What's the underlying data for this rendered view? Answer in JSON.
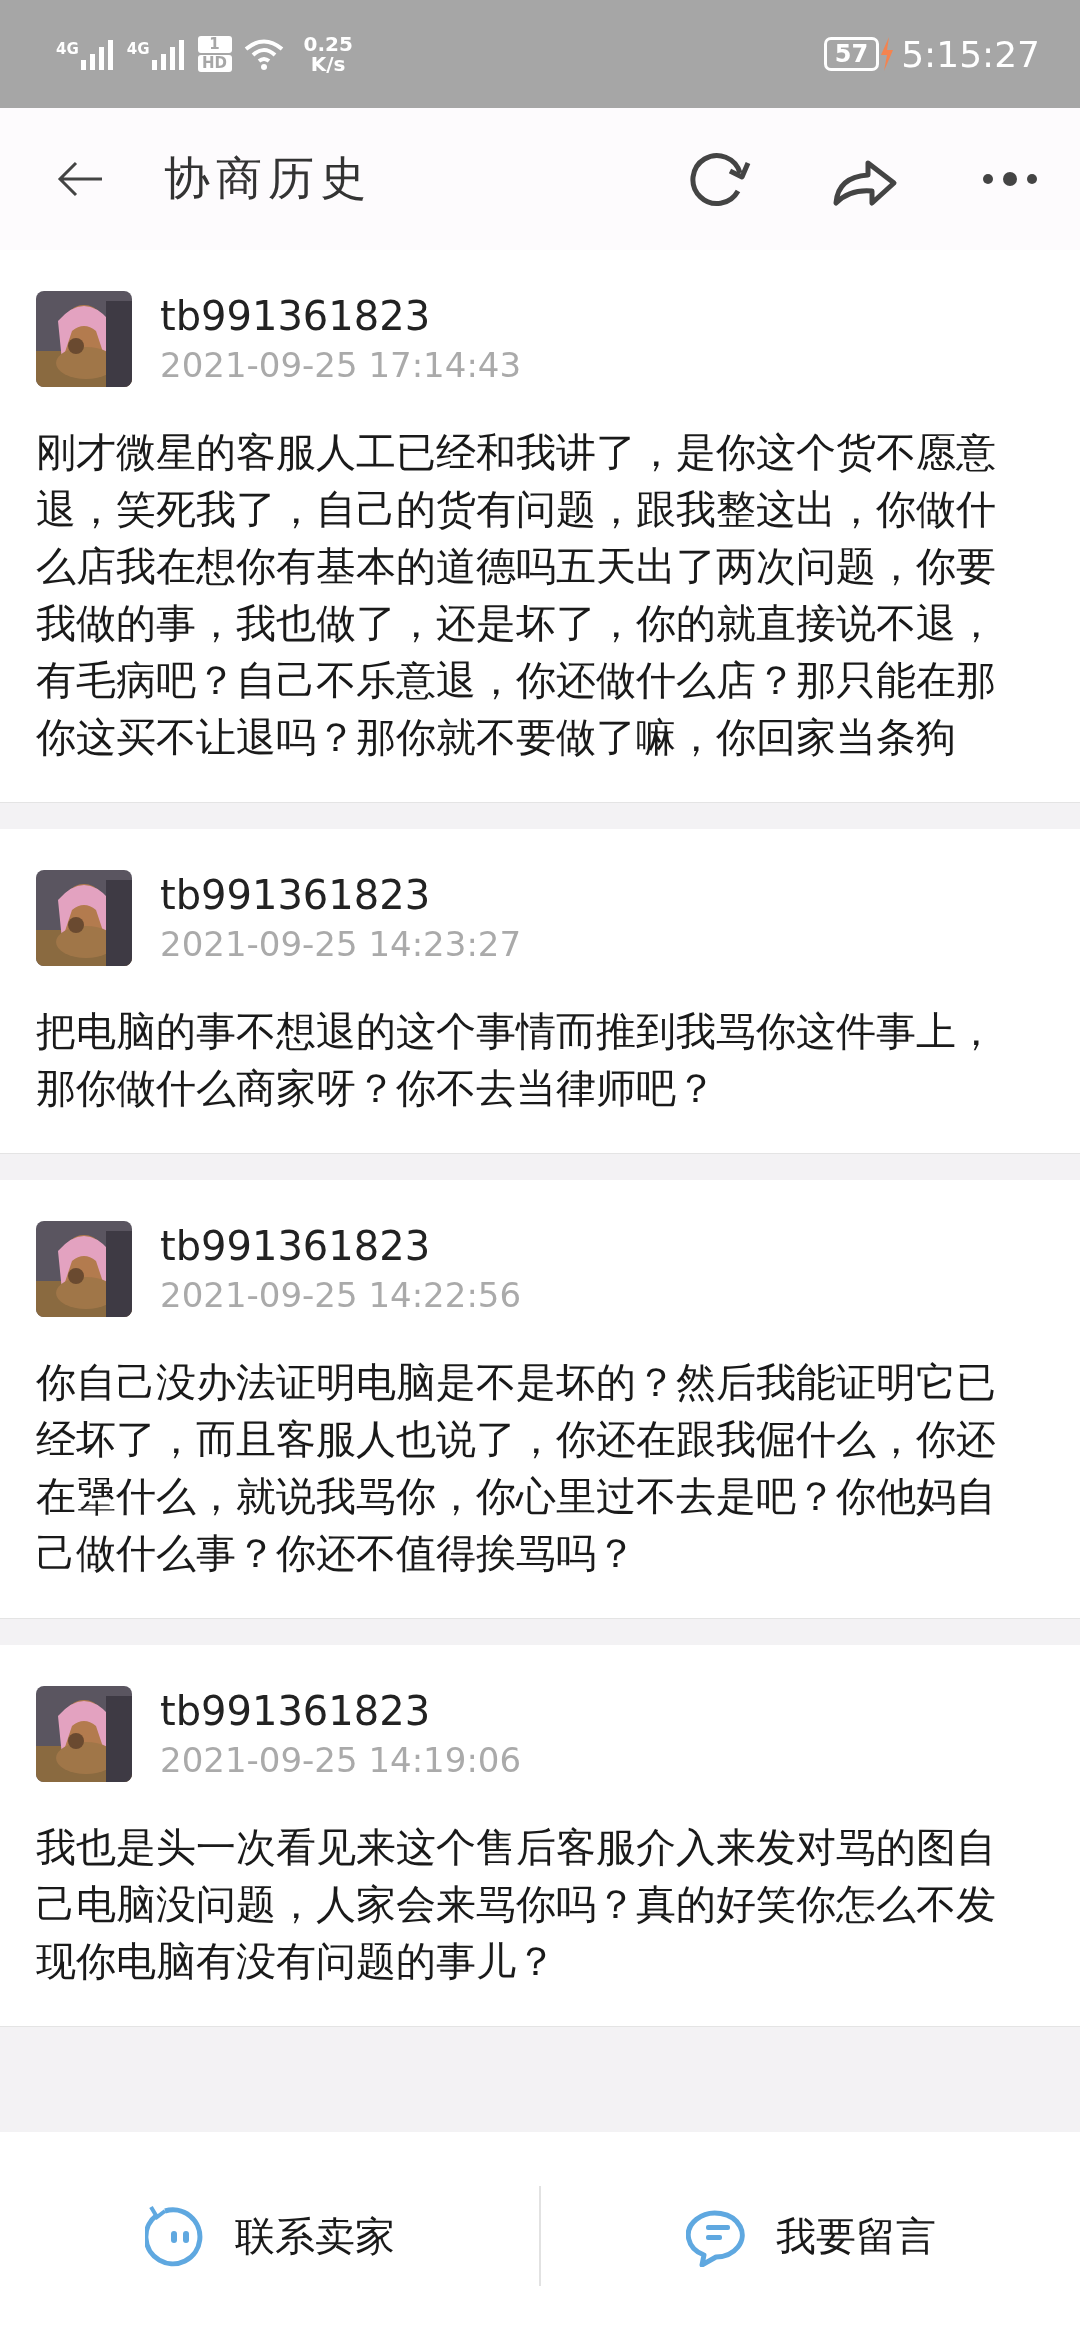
{
  "status_bar": {
    "network_1": "4G",
    "network_2": "4G",
    "sim": "1",
    "hd": "HD",
    "speed": "0.25",
    "speed_unit": "K/s",
    "battery": "57",
    "time": "5:15:27"
  },
  "header": {
    "title": "协商历史"
  },
  "messages": [
    {
      "user": "tb991361823",
      "time": "2021-09-25 17:14:43",
      "text": "刚才微星的客服人工已经和我讲了，是你这个货不愿意退，笑死我了，自己的货有问题，跟我整这出，你做什么店我在想你有基本的道德吗五天出了两次问题，你要我做的事，我也做了，还是坏了，你的就直接说不退，有毛病吧？自己不乐意退，你还做什么店？那只能在那你这买不让退吗？那你就不要做了嘛，你回家当条狗"
    },
    {
      "user": "tb991361823",
      "time": "2021-09-25 14:23:27",
      "text": "把电脑的事不想退的这个事情而推到我骂你这件事上，那你做什么商家呀？你不去当律师吧？"
    },
    {
      "user": "tb991361823",
      "time": "2021-09-25 14:22:56",
      "text": "你自己没办法证明电脑是不是坏的？然后我能证明它已经坏了，而且客服人也说了，你还在跟我倔什么，你还在犟什么，就说我骂你，你心里过不去是吧？你他妈自己做什么事？你还不值得挨骂吗？"
    },
    {
      "user": "tb991361823",
      "time": "2021-09-25 14:19:06",
      "text": "我也是头一次看见来这个售后客服介入来发对骂的图自己电脑没问题，人家会来骂你吗？真的好笑你怎么不发现你电脑有没有问题的事儿？"
    }
  ],
  "bottom_bar": [
    {
      "kind": "contact",
      "label": "联系卖家"
    },
    {
      "kind": "comment",
      "label": "我要留言"
    }
  ]
}
